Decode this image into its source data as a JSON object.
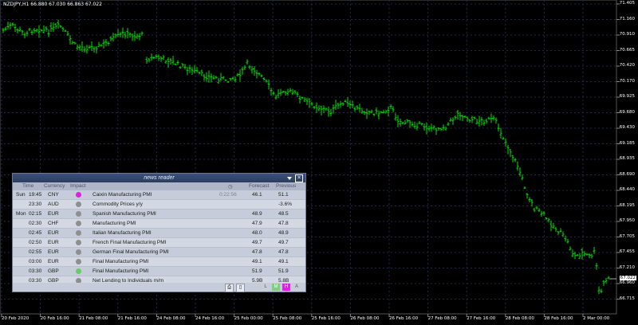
{
  "chart": {
    "title": "NZDJPY,H1  66.880 67.030 66.863 67.022",
    "current_price": "67.022",
    "price_labels": [
      "71.405",
      "71.160",
      "70.910",
      "70.665",
      "70.420",
      "70.170",
      "69.925",
      "69.680",
      "69.430",
      "69.185",
      "68.935",
      "68.690",
      "68.440",
      "68.195",
      "67.950",
      "67.705",
      "67.455",
      "67.210",
      "66.960",
      "66.715"
    ],
    "date_labels": [
      "20 Feb 2020",
      "20 Feb 16:00",
      "21 Feb 08:00",
      "21 Feb 16:00",
      "24 Feb 08:00",
      "24 Feb 16:00",
      "25 Feb 00:00",
      "25 Feb 08:00",
      "25 Feb 16:00",
      "26 Feb 08:00",
      "26 Feb 16:00",
      "27 Feb 08:00",
      "27 Feb 16:00",
      "28 Feb 08:00",
      "28 Feb 16:00",
      "2 Mar 00:00"
    ],
    "bar_color": "#00e000",
    "grid_color": "#1f2a4a"
  },
  "news": {
    "title": "news reader",
    "columns": {
      "time": "Time",
      "currency": "Currency",
      "impact": "Impact",
      "forecast": "Forecast",
      "previous": "Previous"
    },
    "rows": [
      {
        "day": "Sun",
        "time": "19:45",
        "cur": "CNY",
        "impact": "#e020e0",
        "event": "Caixin Manufacturing PMI",
        "countdown": "0:22:56",
        "forecast": "46.1",
        "previous": "51.1"
      },
      {
        "day": "",
        "time": "23:30",
        "cur": "AUD",
        "impact": "#8e8e8e",
        "event": "Commodity Prices y/y",
        "countdown": "",
        "forecast": "",
        "previous": "-3.6%"
      },
      {
        "day": "Mon",
        "time": "02:15",
        "cur": "EUR",
        "impact": "#8e8e8e",
        "event": "Spanish Manufacturing PMI",
        "countdown": "",
        "forecast": "48.9",
        "previous": "48.5"
      },
      {
        "day": "",
        "time": "02:30",
        "cur": "CHF",
        "impact": "#8e8e8e",
        "event": "Manufacturing PMI",
        "countdown": "",
        "forecast": "47.9",
        "previous": "47.8"
      },
      {
        "day": "",
        "time": "02:45",
        "cur": "EUR",
        "impact": "#8e8e8e",
        "event": "Italian Manufacturing PMI",
        "countdown": "",
        "forecast": "48.0",
        "previous": "48.9"
      },
      {
        "day": "",
        "time": "02:50",
        "cur": "EUR",
        "impact": "#8e8e8e",
        "event": "French Final Manufacturing PMI",
        "countdown": "",
        "forecast": "49.7",
        "previous": "49.7"
      },
      {
        "day": "",
        "time": "02:55",
        "cur": "EUR",
        "impact": "#8e8e8e",
        "event": "German Final Manufacturing PMI",
        "countdown": "",
        "forecast": "47.8",
        "previous": "47.8"
      },
      {
        "day": "",
        "time": "03:00",
        "cur": "EUR",
        "impact": "#8e8e8e",
        "event": "Final Manufacturing PMI",
        "countdown": "",
        "forecast": "49.1",
        "previous": "49.1"
      },
      {
        "day": "",
        "time": "03:30",
        "cur": "GBP",
        "impact": "#66cc66",
        "event": "Final Manufacturing PMI",
        "countdown": "",
        "forecast": "51.9",
        "previous": "51.9"
      },
      {
        "day": "",
        "time": "03:30",
        "cur": "GBP",
        "impact": "#8e8e8e",
        "event": "Net Lending to Individuals m/m",
        "countdown": "",
        "forecast": "5.9B",
        "previous": "5.8B"
      }
    ],
    "filters": [
      "L",
      "M",
      "H",
      "A"
    ]
  }
}
